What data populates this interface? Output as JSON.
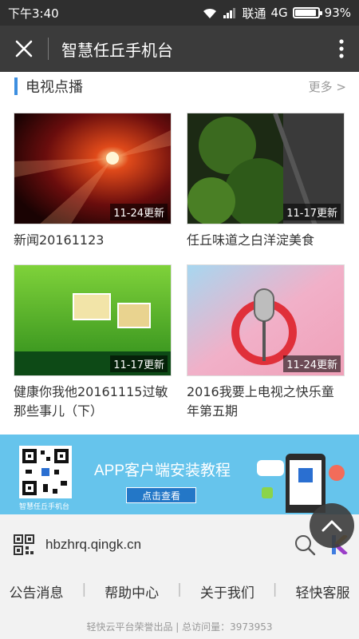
{
  "status_bar": {
    "time": "下午3:40",
    "carrier": "联通",
    "network": "4G",
    "battery": "93%",
    "battery_level": 0.93
  },
  "title_bar": {
    "title": "智慧任丘手机台",
    "close_icon": "close-icon",
    "more_icon": "more-vert-icon"
  },
  "section": {
    "title": "电视点播",
    "more_label": "更多 >",
    "accent": "#3d8fe0"
  },
  "videos": [
    {
      "title": "新闻20161123",
      "badge": "11-24更新"
    },
    {
      "title": "任丘味道之白洋淀美食",
      "badge": "11-17更新"
    },
    {
      "title": "健康你我他20161115过敏那些事儿（下）",
      "badge": "11-17更新"
    },
    {
      "title": "2016我要上电视之快乐童年第五期",
      "badge": "11-24更新"
    }
  ],
  "banner": {
    "title": "APP客户端安装教程",
    "cta": "点击查看",
    "caption": "智慧任丘手机台"
  },
  "footer": {
    "url": "hbzhrq.qingk.cn",
    "links": [
      "公告消息",
      "帮助中心",
      "关于我们",
      "轻快客服"
    ],
    "copyright": "轻快云平台荣誉出品 | 总访问量：3973953"
  }
}
